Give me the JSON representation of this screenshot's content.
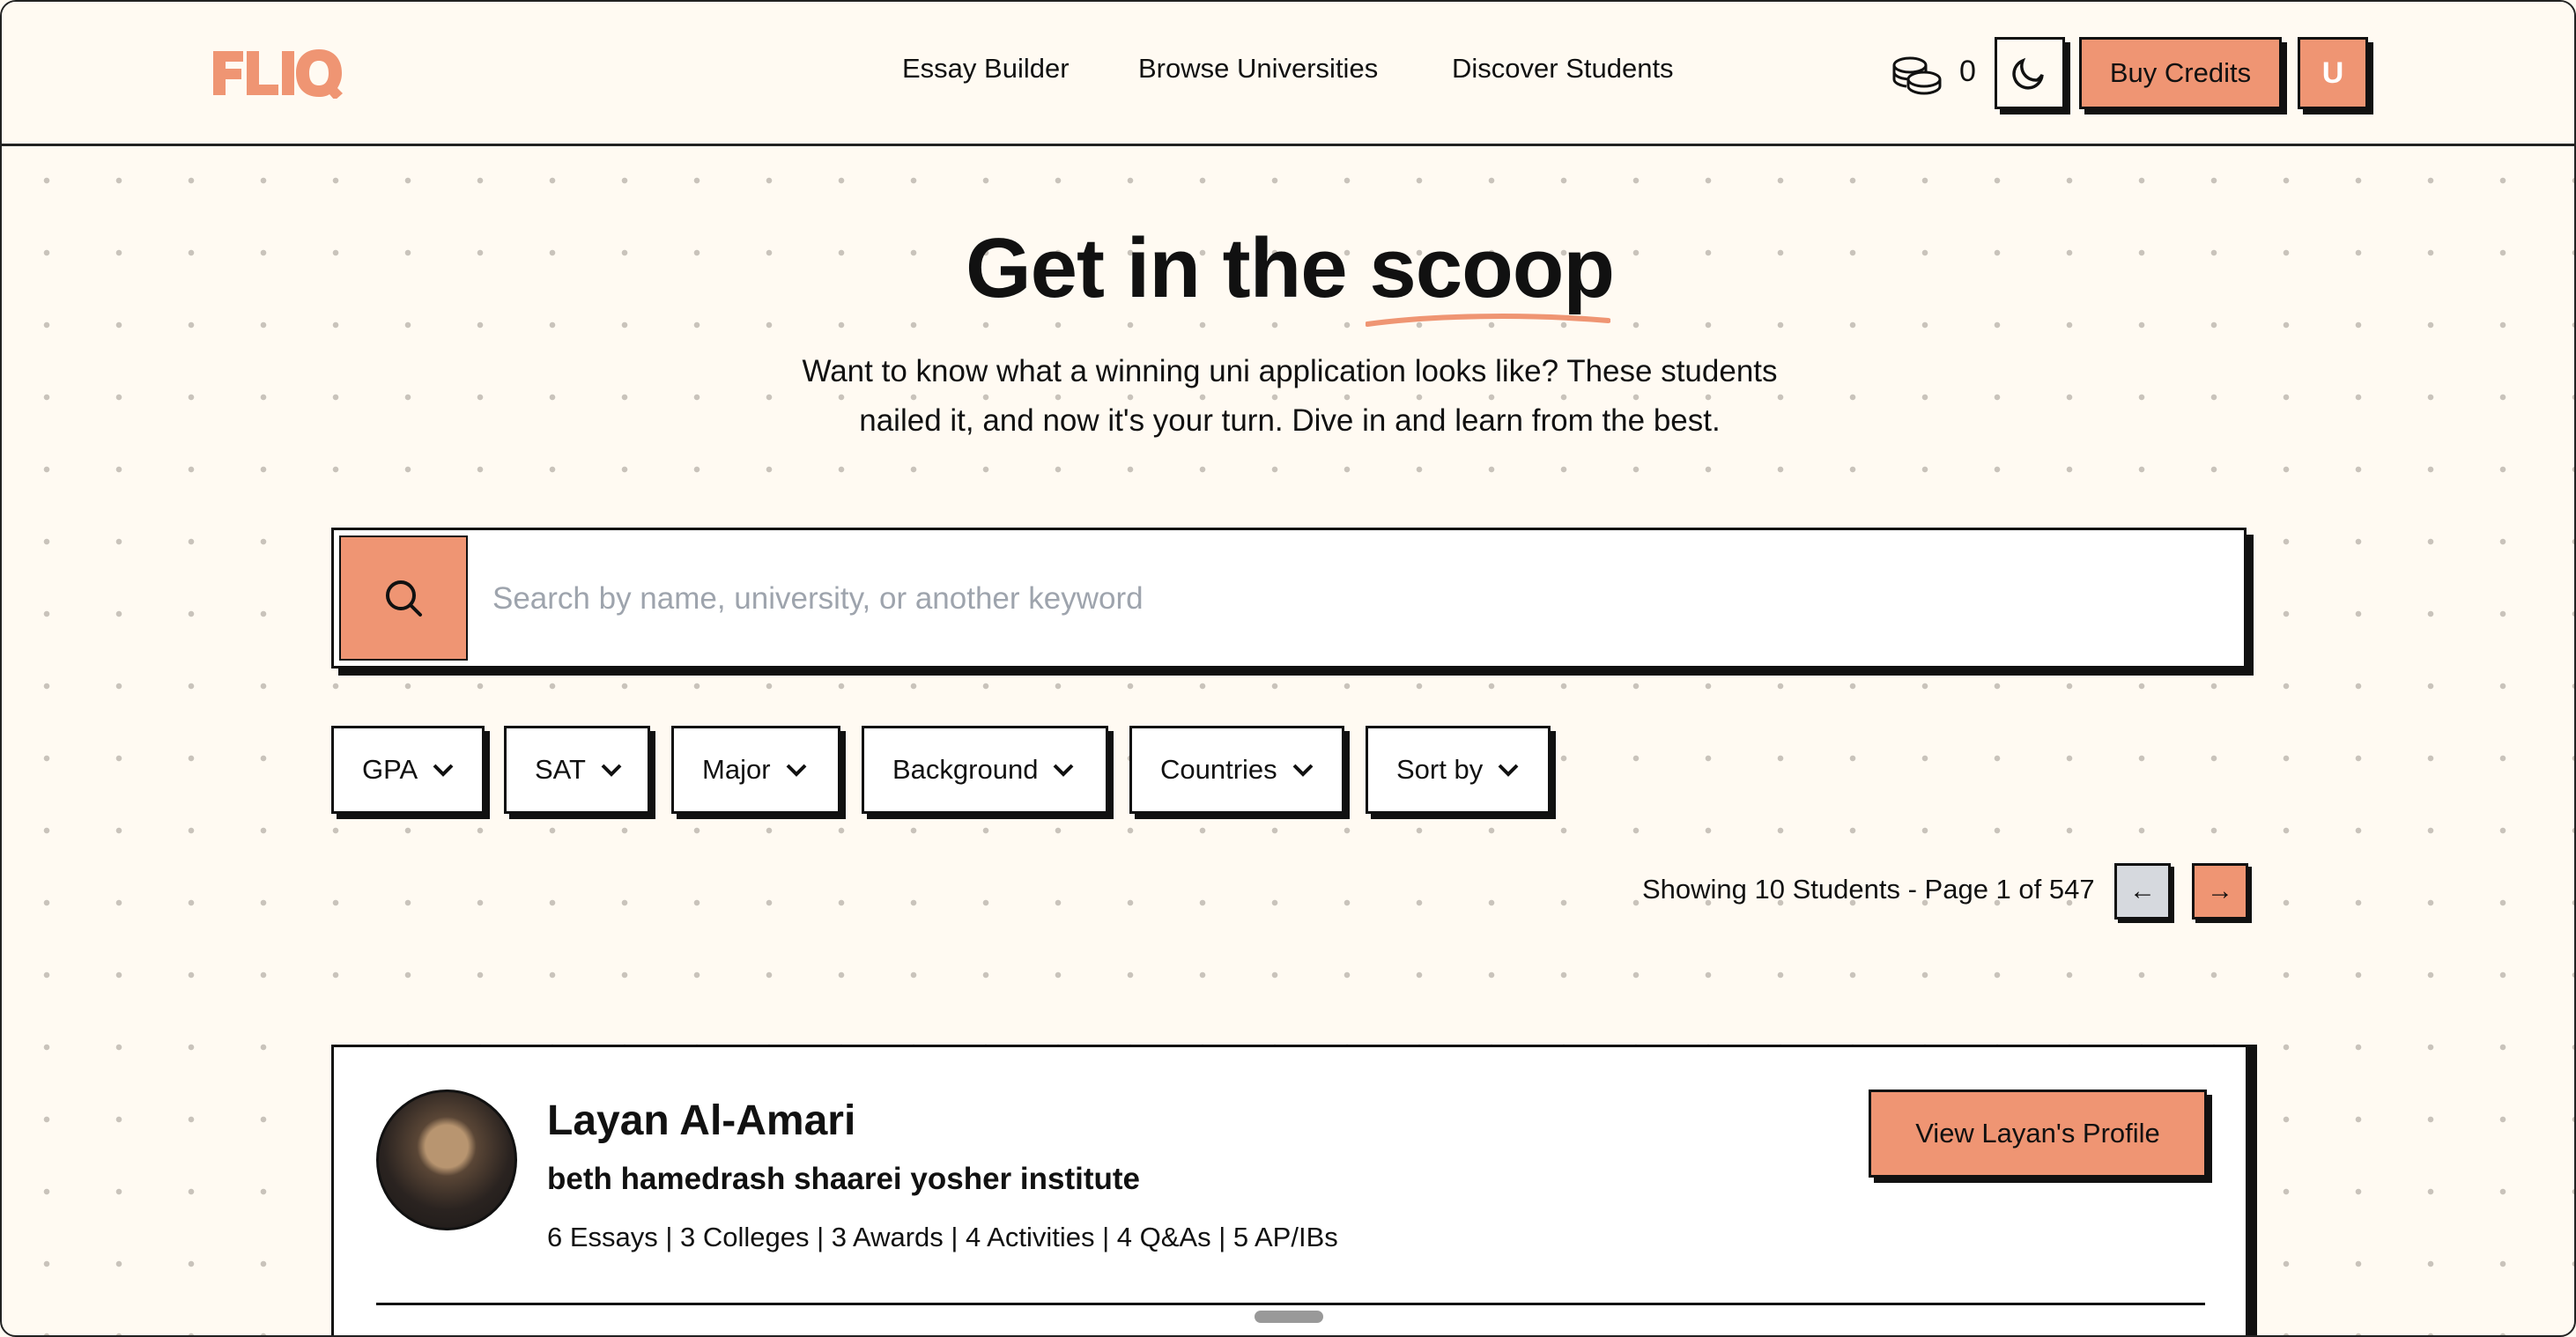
{
  "header": {
    "logo_text": "FLIQ",
    "nav": [
      "Essay Builder",
      "Browse Universities",
      "Discover Students"
    ],
    "credit_count": "0",
    "buy_credits_label": "Buy Credits",
    "user_initial": "U"
  },
  "hero": {
    "title_main": "Get in the",
    "title_highlight": "scoop",
    "subtitle_line1": "Want to know what a winning uni application looks like? These students",
    "subtitle_line2": "nailed it, and now it's your turn. Dive in and learn from the best."
  },
  "search": {
    "placeholder": "Search by name, university, or another keyword",
    "value": ""
  },
  "filters": [
    "GPA",
    "SAT",
    "Major",
    "Background",
    "Countries",
    "Sort by"
  ],
  "pagination": {
    "summary": "Showing 10 Students - Page 1 of 547",
    "prev_label": "←",
    "next_label": "→"
  },
  "students": [
    {
      "name": "Layan Al-Amari",
      "school": "beth hamedrash shaarei yosher institute",
      "stats": "6 Essays | 3 Colleges | 3 Awards | 4 Activities | 4 Q&As | 5 AP/IBs",
      "profile_button": "View Layan's Profile"
    }
  ],
  "colors": {
    "accent": "#ef9573",
    "background": "#fffaf2",
    "ink": "#111111"
  }
}
